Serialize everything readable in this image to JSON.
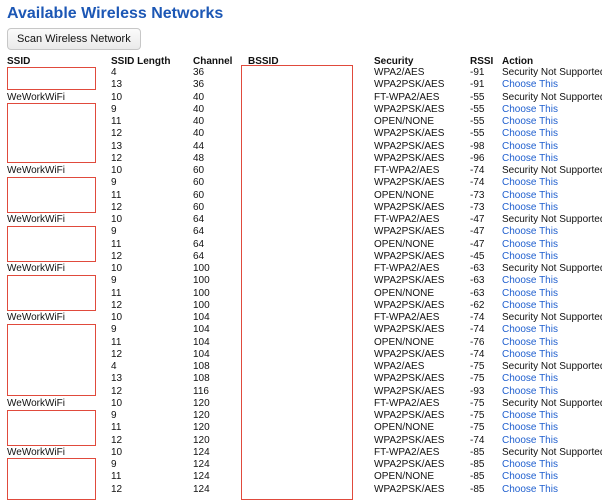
{
  "title": "Available Wireless Networks",
  "scan_button": "Scan Wireless Network",
  "columns": [
    "SSID",
    "SSID Length",
    "Channel",
    "BSSID",
    "Security",
    "RSSI",
    "Action"
  ],
  "rows": [
    {
      "ssid": "",
      "len": "4",
      "ch": "36",
      "sec": "WPA2/AES",
      "rssi": "-91",
      "action": "Security Not Supported"
    },
    {
      "ssid": "",
      "len": "13",
      "ch": "36",
      "sec": "WPA2PSK/AES",
      "rssi": "-91",
      "action": "Choose This"
    },
    {
      "ssid": "WeWorkWiFi",
      "len": "10",
      "ch": "40",
      "sec": "FT-WPA2/AES",
      "rssi": "-55",
      "action": "Security Not Supported"
    },
    {
      "ssid": "",
      "len": "9",
      "ch": "40",
      "sec": "WPA2PSK/AES",
      "rssi": "-55",
      "action": "Choose This"
    },
    {
      "ssid": "",
      "len": "11",
      "ch": "40",
      "sec": "OPEN/NONE",
      "rssi": "-55",
      "action": "Choose This"
    },
    {
      "ssid": "",
      "len": "12",
      "ch": "40",
      "sec": "WPA2PSK/AES",
      "rssi": "-55",
      "action": "Choose This"
    },
    {
      "ssid": "",
      "len": "13",
      "ch": "44",
      "sec": "WPA2PSK/AES",
      "rssi": "-98",
      "action": "Choose This"
    },
    {
      "ssid": "",
      "len": "12",
      "ch": "48",
      "sec": "WPA2PSK/AES",
      "rssi": "-96",
      "action": "Choose This"
    },
    {
      "ssid": "WeWorkWiFi",
      "len": "10",
      "ch": "60",
      "sec": "FT-WPA2/AES",
      "rssi": "-74",
      "action": "Security Not Supported"
    },
    {
      "ssid": "",
      "len": "9",
      "ch": "60",
      "sec": "WPA2PSK/AES",
      "rssi": "-74",
      "action": "Choose This"
    },
    {
      "ssid": "",
      "len": "11",
      "ch": "60",
      "sec": "OPEN/NONE",
      "rssi": "-73",
      "action": "Choose This"
    },
    {
      "ssid": "",
      "len": "12",
      "ch": "60",
      "sec": "WPA2PSK/AES",
      "rssi": "-73",
      "action": "Choose This"
    },
    {
      "ssid": "WeWorkWiFi",
      "len": "10",
      "ch": "64",
      "sec": "FT-WPA2/AES",
      "rssi": "-47",
      "action": "Security Not Supported"
    },
    {
      "ssid": "",
      "len": "9",
      "ch": "64",
      "sec": "WPA2PSK/AES",
      "rssi": "-47",
      "action": "Choose This"
    },
    {
      "ssid": "",
      "len": "11",
      "ch": "64",
      "sec": "OPEN/NONE",
      "rssi": "-47",
      "action": "Choose This"
    },
    {
      "ssid": "",
      "len": "12",
      "ch": "64",
      "sec": "WPA2PSK/AES",
      "rssi": "-45",
      "action": "Choose This"
    },
    {
      "ssid": "WeWorkWiFi",
      "len": "10",
      "ch": "100",
      "sec": "FT-WPA2/AES",
      "rssi": "-63",
      "action": "Security Not Supported"
    },
    {
      "ssid": "",
      "len": "9",
      "ch": "100",
      "sec": "WPA2PSK/AES",
      "rssi": "-63",
      "action": "Choose This"
    },
    {
      "ssid": "",
      "len": "11",
      "ch": "100",
      "sec": "OPEN/NONE",
      "rssi": "-63",
      "action": "Choose This"
    },
    {
      "ssid": "",
      "len": "12",
      "ch": "100",
      "sec": "WPA2PSK/AES",
      "rssi": "-62",
      "action": "Choose This"
    },
    {
      "ssid": "WeWorkWiFi",
      "len": "10",
      "ch": "104",
      "sec": "FT-WPA2/AES",
      "rssi": "-74",
      "action": "Security Not Supported"
    },
    {
      "ssid": "",
      "len": "9",
      "ch": "104",
      "sec": "WPA2PSK/AES",
      "rssi": "-74",
      "action": "Choose This"
    },
    {
      "ssid": "",
      "len": "11",
      "ch": "104",
      "sec": "OPEN/NONE",
      "rssi": "-76",
      "action": "Choose This"
    },
    {
      "ssid": "",
      "len": "12",
      "ch": "104",
      "sec": "WPA2PSK/AES",
      "rssi": "-74",
      "action": "Choose This"
    },
    {
      "ssid": "",
      "len": "4",
      "ch": "108",
      "sec": "WPA2/AES",
      "rssi": "-75",
      "action": "Security Not Supported"
    },
    {
      "ssid": "",
      "len": "13",
      "ch": "108",
      "sec": "WPA2PSK/AES",
      "rssi": "-75",
      "action": "Choose This"
    },
    {
      "ssid": "",
      "len": "12",
      "ch": "116",
      "sec": "WPA2PSK/AES",
      "rssi": "-93",
      "action": "Choose This"
    },
    {
      "ssid": "WeWorkWiFi",
      "len": "10",
      "ch": "120",
      "sec": "FT-WPA2/AES",
      "rssi": "-75",
      "action": "Security Not Supported"
    },
    {
      "ssid": "",
      "len": "9",
      "ch": "120",
      "sec": "WPA2PSK/AES",
      "rssi": "-75",
      "action": "Choose This"
    },
    {
      "ssid": "",
      "len": "11",
      "ch": "120",
      "sec": "OPEN/NONE",
      "rssi": "-75",
      "action": "Choose This"
    },
    {
      "ssid": "",
      "len": "12",
      "ch": "120",
      "sec": "WPA2PSK/AES",
      "rssi": "-74",
      "action": "Choose This"
    },
    {
      "ssid": "WeWorkWiFi",
      "len": "10",
      "ch": "124",
      "sec": "FT-WPA2/AES",
      "rssi": "-85",
      "action": "Security Not Supported"
    },
    {
      "ssid": "",
      "len": "9",
      "ch": "124",
      "sec": "WPA2PSK/AES",
      "rssi": "-85",
      "action": "Choose This"
    },
    {
      "ssid": "",
      "len": "11",
      "ch": "124",
      "sec": "OPEN/NONE",
      "rssi": "-85",
      "action": "Choose This"
    },
    {
      "ssid": "",
      "len": "12",
      "ch": "124",
      "sec": "WPA2PSK/AES",
      "rssi": "-85",
      "action": "Choose This"
    }
  ]
}
